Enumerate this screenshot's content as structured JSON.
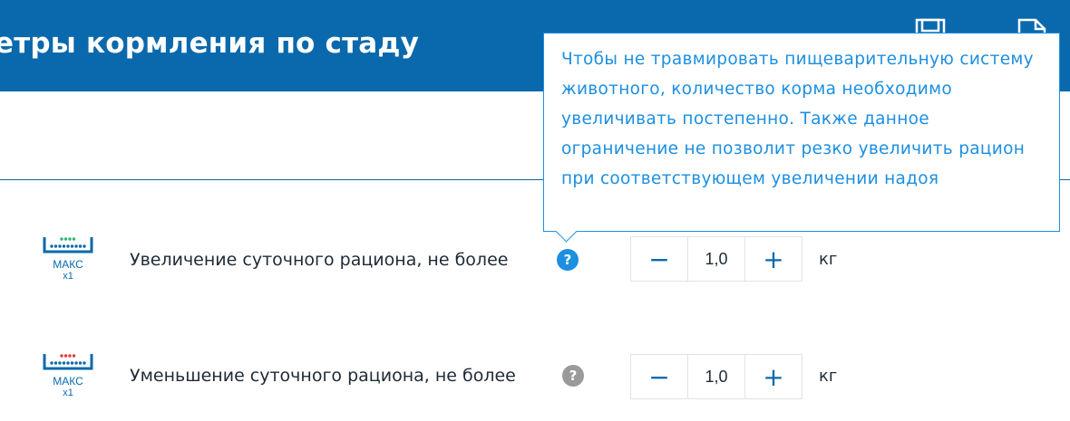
{
  "header": {
    "title": "етры кормления по стаду",
    "icons": [
      "save-icon",
      "new-document-icon"
    ]
  },
  "rows": [
    {
      "icon": "trough-increase-icon",
      "icon_maks": "МАКС",
      "icon_mult": "x1",
      "label": "Увеличение суточного рациона, не более",
      "help": "?",
      "value": "1,0",
      "minus": "−",
      "plus": "+",
      "unit": "кг"
    },
    {
      "icon": "trough-decrease-icon",
      "icon_maks": "МАКС",
      "icon_mult": "x1",
      "label": "Уменьшение суточного рациона, не более",
      "help": "?",
      "value": "1,0",
      "minus": "−",
      "plus": "+",
      "unit": "кг"
    }
  ],
  "tooltip": {
    "text": "Чтобы не травмировать пищеварительную систему животного, количество корма необходимо увеличивать постепенно. Также данное ограничение не позволит резко увеличить рацион при соответствующем увеличении надоя"
  },
  "colors": {
    "brand": "#0a69ad",
    "accent": "#1c8fe0",
    "increase_dots": "#2bb673",
    "decrease_dots": "#e53935",
    "help_inactive": "#9a9a9a"
  }
}
